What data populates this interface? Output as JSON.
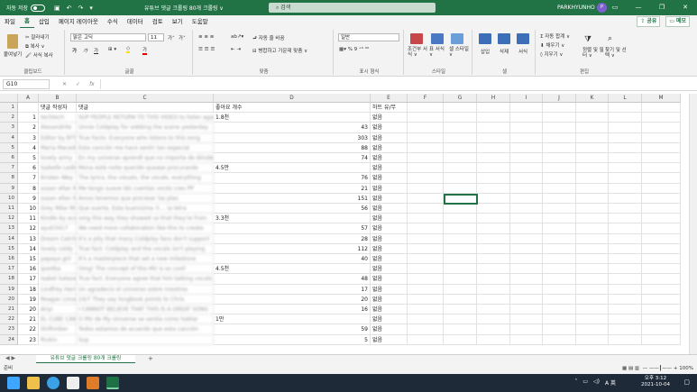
{
  "titlebar": {
    "autosave": "자동 저장",
    "toggle": "끔",
    "doc_title": "유튜브 댓글 크롤링 80개 크롤링 ∨",
    "search_placeholder": "검색",
    "user": "PARKHYUNHO",
    "avatar": "P"
  },
  "menu": {
    "tabs": [
      "파일",
      "홈",
      "삽입",
      "페이지 레이아웃",
      "수식",
      "데이터",
      "검토",
      "보기",
      "도움말"
    ],
    "active": "홈",
    "share": "공유",
    "memo": "메모"
  },
  "ribbon": {
    "clipboard": {
      "paste": "붙여넣기",
      "cut": "잘라내기",
      "copy": "복사 ∨",
      "format_painter": "서식 복사",
      "label": "클립보드"
    },
    "font": {
      "name": "맑은 고딕",
      "size": "11",
      "grow": "가˄",
      "shrink": "가˅",
      "bold": "가",
      "italic": "가",
      "underline": "가",
      "label": "글꼴"
    },
    "align": {
      "wrap": "자동 줄 바꿈",
      "merge": "병합하고 가운데 맞춤 ∨",
      "label": "맞춤"
    },
    "number": {
      "format": "일반",
      "label": "표시 형식"
    },
    "styles": {
      "cond": "조건부 서식 ∨",
      "table": "표 서식 ∨",
      "cell": "셀 스타일 ∨",
      "label": "스타일"
    },
    "cells": {
      "insert": "삽입",
      "delete": "삭제",
      "format": "서식",
      "label": "셀"
    },
    "editing": {
      "autosum": "자동 합계 ∨",
      "fill": "채우기 ∨",
      "clear": "지우기 ∨",
      "sort": "정렬 및 필터 ∨",
      "find": "찾기 및 선택 ∨",
      "label": "편집"
    }
  },
  "formula": {
    "namebox": "G10",
    "fx": "fx",
    "value": ""
  },
  "columns": [
    "A",
    "B",
    "C",
    "D",
    "E",
    "F",
    "G",
    "H",
    "I",
    "J",
    "K",
    "L",
    "M"
  ],
  "headers": {
    "B": "댓글 작성자",
    "C": "댓글",
    "D": "좋아요 개수",
    "E": "하트 유/무"
  },
  "rows": [
    {
      "n": 1,
      "a": "",
      "b": "댓글 작성자",
      "c": "댓글",
      "d": "좋아요 개수",
      "e": "하트 유/무"
    },
    {
      "n": 2,
      "a": "1",
      "b": "techtech",
      "c": "SUP PEOPLE RETURN TO THIS VIDEO to listen again",
      "d": "1.8천",
      "e": "없음"
    },
    {
      "n": 3,
      "a": "2",
      "b": "Alexandrite",
      "c": "Unnie Coldplay for sobbing the scene yesterday",
      "d": "43",
      "e": "없음"
    },
    {
      "n": 4,
      "a": "3",
      "b": "Editor by BTS",
      "c": "True Facts: Everyone who listens to this song",
      "d": "303",
      "e": "없음"
    },
    {
      "n": 5,
      "a": "4",
      "b": "Maria Macedo Pileira",
      "c": "Esta canción me hace sentir tan especial",
      "d": "88",
      "e": "없음"
    },
    {
      "n": 6,
      "a": "5",
      "b": "lovely army",
      "c": "En my universe aprendí que no importa de dónde",
      "d": "74",
      "e": "없음"
    },
    {
      "n": 7,
      "a": "6",
      "b": "Isabelle Ledlow",
      "c": "Mona está noite querido quaase procurando",
      "d": "4.5만",
      "e": "없음"
    },
    {
      "n": 8,
      "a": "7",
      "b": "Kristen Wey",
      "c": "The lyrics, the visuals, the vocals, everything",
      "d": "76",
      "e": "없음"
    },
    {
      "n": 9,
      "a": "8",
      "b": "susan ellan Martinez Ramirez",
      "c": "Me tengo suave ido cuentas vocés creo PP",
      "d": "21",
      "e": "없음"
    },
    {
      "n": 10,
      "a": "9",
      "b": "susan ellan Martinez Ramirez",
      "c": "Amos tenemos que procesar las plas",
      "d": "151",
      "e": "없음"
    },
    {
      "n": 11,
      "a": "10",
      "b": "Grey Mike Milano",
      "c": "Que suerte, Esta buenisima ©... la letra",
      "d": "56",
      "e": "없음"
    },
    {
      "n": 12,
      "a": "11",
      "b": "Kindle by ace",
      "c": "omg this way they showed us that they're from",
      "d": "3.3천",
      "e": "없음"
    },
    {
      "n": 13,
      "a": "12",
      "b": "ayuti3417",
      "c": "We need more collaboration like this to create",
      "d": "57",
      "e": "없음"
    },
    {
      "n": 14,
      "a": "13",
      "b": "Dream Catcher",
      "c": "It's a pity that many Coldplay fans don't support",
      "d": "28",
      "e": "없음"
    },
    {
      "n": 15,
      "a": "14",
      "b": "lovely coldy",
      "c": "True fact: Coldplay and the vocals isn't playing",
      "d": "112",
      "e": "없음"
    },
    {
      "n": 16,
      "a": "15",
      "b": "papaya girl",
      "c": "It's a masterpiece that set a new milestone",
      "d": "40",
      "e": "없음"
    },
    {
      "n": 17,
      "a": "16",
      "b": "ipootka",
      "c": "Omg! The concept of this MV is so cool!",
      "d": "4.5천",
      "e": "없음"
    },
    {
      "n": 18,
      "a": "17",
      "b": "Isabel Salazar",
      "c": "True fact: Everyone agree that him talking vocals",
      "d": "48",
      "e": "없음"
    },
    {
      "n": 19,
      "a": "18",
      "b": "Lindfrey Hernández",
      "c": "Un agradecio el universo sobre nosotros",
      "d": "17",
      "e": "없음"
    },
    {
      "n": 20,
      "a": "19",
      "b": "Reagan Lima Del Rosario",
      "c": "24/7 They say longbook points to Chris",
      "d": "20",
      "e": "없음"
    },
    {
      "n": 21,
      "a": "20",
      "b": "Ariyi",
      "c": "I CANNOT BELIEVE THAT THIS IS A GREAT SONG",
      "d": "16",
      "e": "없음"
    },
    {
      "n": 22,
      "a": "21",
      "b": "EL CUBE CAKNA",
      "c": "O MV de My Universe se sentía como hablar",
      "d": "1만",
      "e": "없음"
    },
    {
      "n": 23,
      "a": "22",
      "b": "Shiftmiker",
      "c": "Todos estamos de acuerdo que esta canción",
      "d": "59",
      "e": "없음"
    },
    {
      "n": 24,
      "a": "23",
      "b": "Rivkin",
      "c": "Sup",
      "d": "5",
      "e": "없음"
    }
  ],
  "sheet": {
    "tab": "유튜브 댓글 크롤링 80개 크롤링",
    "add": "+"
  },
  "status": {
    "ready": "준비",
    "zoom": "100%"
  },
  "taskbar": {
    "time": "오후 3:12",
    "date": "2021-10-04",
    "lang": "A 英"
  }
}
